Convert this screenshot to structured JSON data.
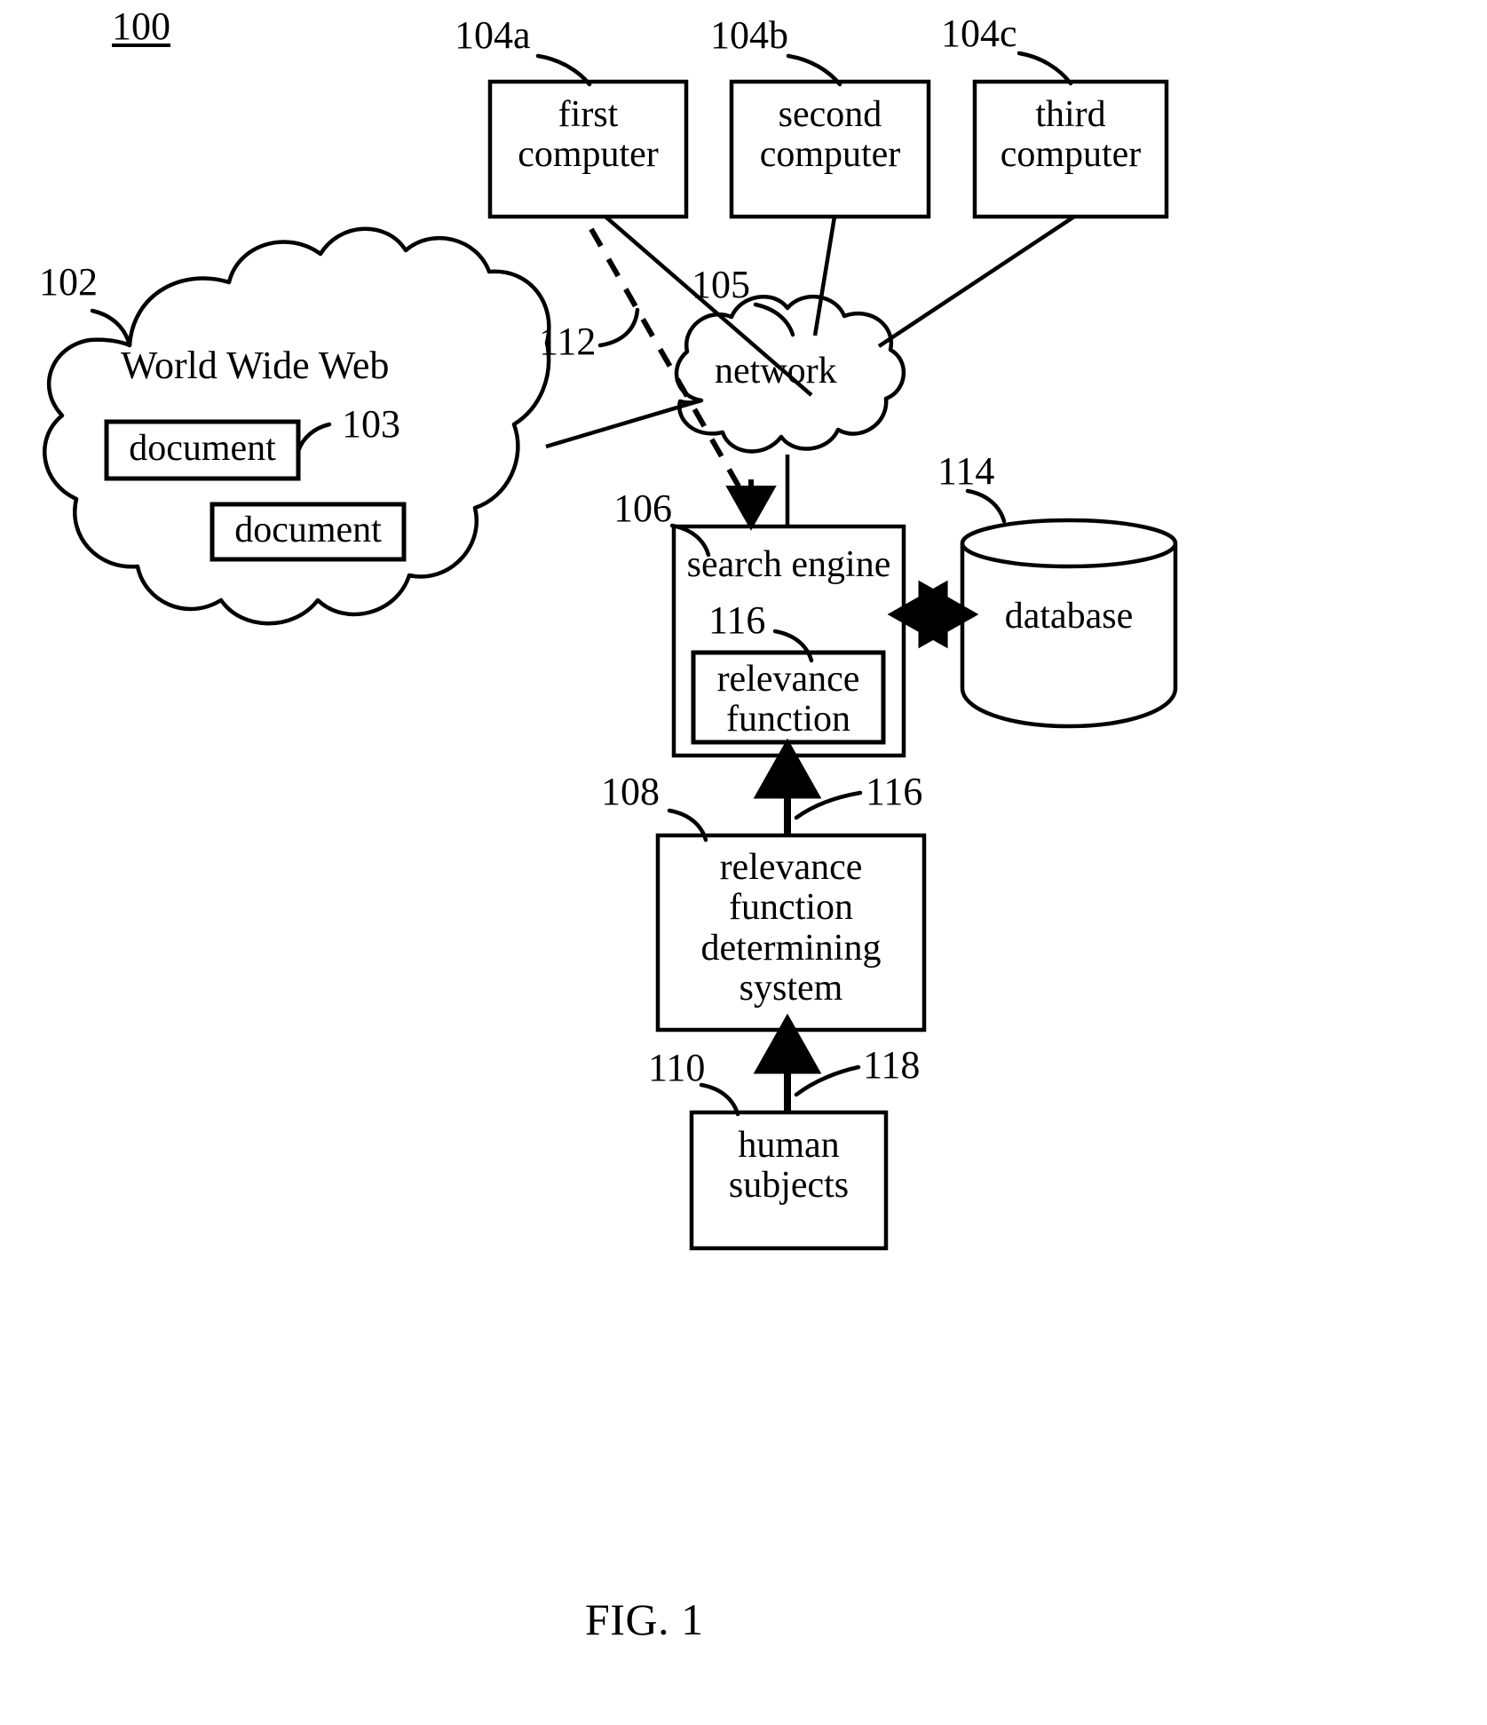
{
  "figure": {
    "caption": "FIG. 1",
    "system_ref": "100"
  },
  "refs": {
    "system": "100",
    "www": "102",
    "document": "103",
    "first_computer": "104a",
    "second_computer": "104b",
    "third_computer": "104c",
    "network": "105",
    "search_engine": "106",
    "determining_system": "108",
    "human_subjects": "110",
    "query_link": "112",
    "database": "114",
    "relevance_function_inner": "116",
    "relevance_function_arrow": "116",
    "human_subjects_arrow": "118"
  },
  "nodes": {
    "first_computer": "first\ncomputer",
    "first_computer_line1": "first",
    "first_computer_line2": "computer",
    "second_computer_line1": "second",
    "second_computer_line2": "computer",
    "third_computer_line1": "third",
    "third_computer_line2": "computer",
    "www": "World Wide Web",
    "document_a": "document",
    "document_b": "document",
    "network": "network",
    "search_engine": "search engine",
    "relevance_function_line1": "relevance",
    "relevance_function_line2": "function",
    "database": "database",
    "determining_system_line1": "relevance",
    "determining_system_line2": "function",
    "determining_system_line3": "determining",
    "determining_system_line4": "system",
    "human_subjects_line1": "human",
    "human_subjects_line2": "subjects"
  },
  "colors": {
    "stroke": "#000000",
    "background": "#ffffff"
  }
}
